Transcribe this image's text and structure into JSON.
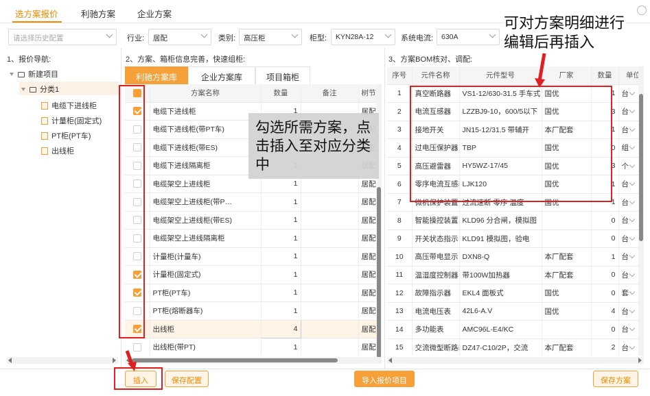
{
  "tabs": [
    "选方案报价",
    "利驰方案",
    "企业方案"
  ],
  "history_placeholder": "请选择历史配置",
  "filters": {
    "industry": {
      "label": "行业:",
      "value": "居配"
    },
    "category": {
      "label": "类别:",
      "value": "高压柜"
    },
    "cabinet": {
      "label": "柜型:",
      "value": "KYN28A-12"
    },
    "voltage": {
      "label": "系统电流:",
      "value": "630A"
    }
  },
  "section1": "1、报价导航:",
  "section2": "2、方案、箱柜信息完善，快速组柜:",
  "section3": "3、方案BOM核对、调配:",
  "tree": {
    "root": "新建项目",
    "group": "分类1",
    "items": [
      "电缆下进线柜",
      "计量柜(固定式)",
      "PT柜(PT车)",
      "出线柜"
    ]
  },
  "subtabs": [
    "利驰方案库",
    "企业方案库",
    "项目箱柜"
  ],
  "mid_headers": [
    "方案名称",
    "数量",
    "备注",
    "树节点"
  ],
  "mid_rows": [
    {
      "name": "电缆下进线柜",
      "qty": "1",
      "note": "",
      "node": "居配",
      "checked": true
    },
    {
      "name": "电缆下进线柜(带PT车)",
      "qty": "1",
      "note": "",
      "node": "居配",
      "checked": false
    },
    {
      "name": "电缆下进线柜(带ES)",
      "qty": "1",
      "note": "",
      "node": "居配",
      "checked": false
    },
    {
      "name": "电缆下进线隔离柜",
      "qty": "1",
      "note": "",
      "node": "居配",
      "checked": false
    },
    {
      "name": "电缆架空上进线柜",
      "qty": "1",
      "note": "",
      "node": "居配",
      "checked": false
    },
    {
      "name": "电缆架空上进线柜(带P…",
      "qty": "1",
      "note": "",
      "node": "居配",
      "checked": false
    },
    {
      "name": "电缆架空上进线柜(带ES)",
      "qty": "1",
      "note": "",
      "node": "居配",
      "checked": false
    },
    {
      "name": "电缆架空上进线隔离柜",
      "qty": "1",
      "note": "",
      "node": "居配",
      "checked": false
    },
    {
      "name": "计量柜(计量车)",
      "qty": "1",
      "note": "",
      "node": "居配",
      "checked": false
    },
    {
      "name": "计量柜(固定式)",
      "qty": "1",
      "note": "",
      "node": "居配",
      "checked": true
    },
    {
      "name": "PT柜(PT车)",
      "qty": "1",
      "note": "",
      "node": "居配",
      "checked": true
    },
    {
      "name": "PT柜(熔断器车)",
      "qty": "1",
      "note": "",
      "node": "居配",
      "checked": false
    },
    {
      "name": "出线柜",
      "qty": "4",
      "note": "",
      "node": "居配",
      "checked": true
    },
    {
      "name": "出线柜(带PT)",
      "qty": "1",
      "note": "",
      "node": "居配",
      "checked": false
    }
  ],
  "bom_headers": [
    "序号",
    "元件名称",
    "元件型号",
    "厂家",
    "数量",
    "单位"
  ],
  "bom_rows": [
    {
      "no": "1",
      "name": "真空断路器",
      "model": "VS1-12/630-31.5 手车式",
      "maker": "国优",
      "qty": "1",
      "unit": "台"
    },
    {
      "no": "2",
      "name": "电流互感器",
      "model": "LZZBJ9-10，600/5以下",
      "maker": "国优",
      "qty": "3",
      "unit": "台"
    },
    {
      "no": "3",
      "name": "接地开关",
      "model": "JN15-12/31.5 带辅开",
      "maker": "本厂配套",
      "qty": "1",
      "unit": "台"
    },
    {
      "no": "4",
      "name": "过电压保护器",
      "model": "TBP",
      "maker": "国优",
      "qty": "0",
      "unit": "组"
    },
    {
      "no": "5",
      "name": "高压避雷器",
      "model": "HY5WZ-17/45",
      "maker": "国优",
      "qty": "3",
      "unit": "个"
    },
    {
      "no": "6",
      "name": "零序电流互感器",
      "model": "LJK120",
      "maker": "国优",
      "qty": "1",
      "unit": "台"
    },
    {
      "no": "7",
      "name": "微机保护装置",
      "model": "过流速断 零序 温度",
      "maker": "国优",
      "qty": "1",
      "unit": "台"
    },
    {
      "no": "8",
      "name": "智能操控装置",
      "model": "KLD96 分合闸，模拟图",
      "maker": "",
      "qty": "0",
      "unit": "台"
    },
    {
      "no": "9",
      "name": "开关状态指示",
      "model": "KLD91 模拟图，验电",
      "maker": "",
      "qty": "0",
      "unit": "台"
    },
    {
      "no": "10",
      "name": "高压带电显示",
      "model": "DXN8-Q",
      "maker": "本厂配套",
      "qty": "1",
      "unit": "台"
    },
    {
      "no": "11",
      "name": "温湿度控制器",
      "model": "带100W加热器",
      "maker": "本厂配套",
      "qty": "0",
      "unit": "台"
    },
    {
      "no": "12",
      "name": "故障指示器",
      "model": "EKL4 面板式",
      "maker": "国优",
      "qty": "0",
      "unit": "套"
    },
    {
      "no": "13",
      "name": "电流电压表",
      "model": "42L6-A.V",
      "maker": "国优",
      "qty": "4",
      "unit": "台"
    },
    {
      "no": "14",
      "name": "多功能表",
      "model": "AMC96L-E4/KC",
      "maker": "",
      "qty": "0",
      "unit": "台"
    },
    {
      "no": "15",
      "name": "交流微型断路器",
      "model": "DZ47-C10/2P，交流",
      "maker": "本厂配套",
      "qty": "2",
      "unit": "台"
    }
  ],
  "buttons": {
    "insert": "插入",
    "save_config": "保存配置",
    "import": "导入报价项目",
    "save_plan": "保存方案"
  },
  "callout_left": "勾选所需方案，点击插入至对应分类中",
  "callout_right": "可对方案明细进行编辑后再插入",
  "colors": {
    "accent": "#f5a038",
    "annotation": "#e02020"
  }
}
